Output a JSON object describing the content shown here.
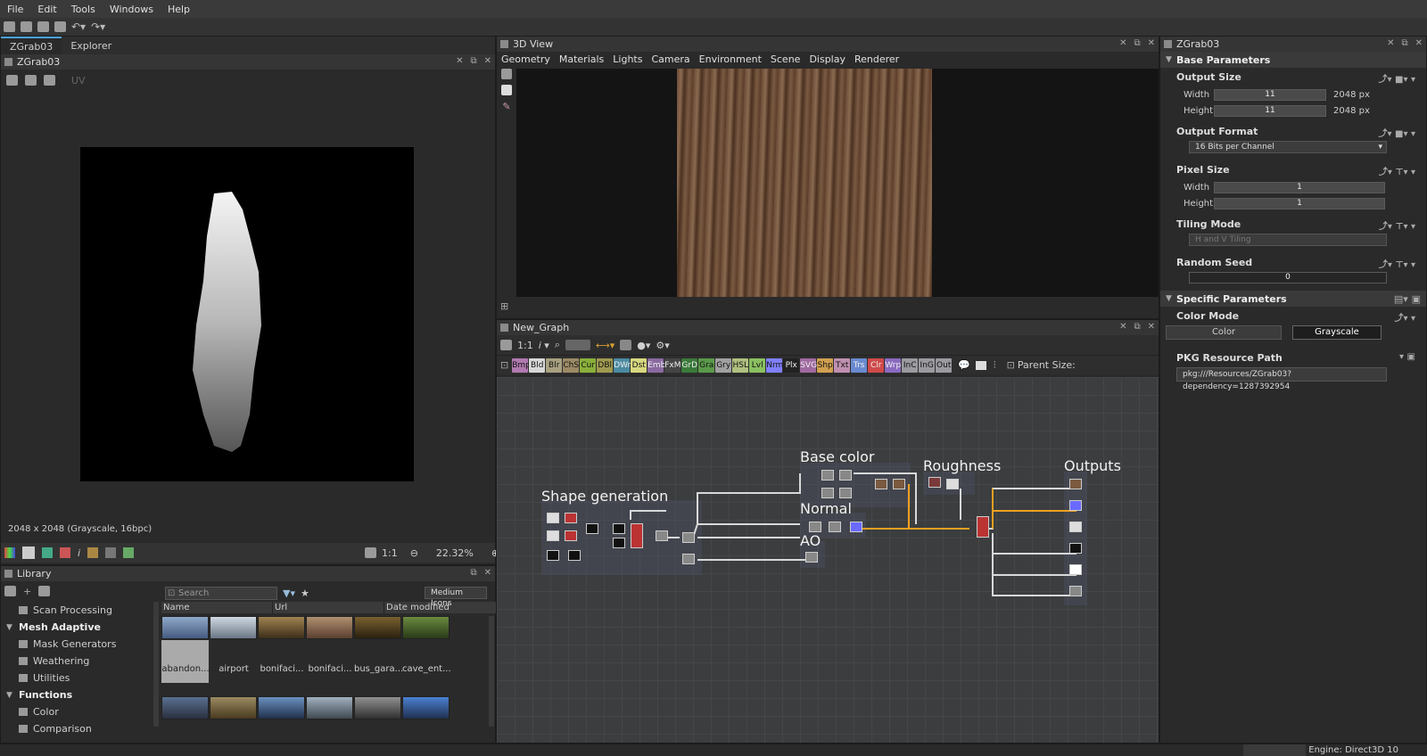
{
  "menu": [
    "File",
    "Edit",
    "Tools",
    "Windows",
    "Help"
  ],
  "left_panel": {
    "tabs": [
      "ZGrab03",
      "Explorer"
    ],
    "title": "ZGrab03",
    "uv_label": "UV",
    "image_info": "2048 x 2048 (Grayscale, 16bpc)",
    "zoom_ratio": "1:1",
    "zoom_percent": "22.32%"
  },
  "library": {
    "title": "Library",
    "search_placeholder": "Search",
    "view_mode": "Medium Icons",
    "columns": [
      "Name",
      "Url",
      "Date modified"
    ],
    "tree": [
      {
        "type": "item",
        "label": "Scan Processing"
      },
      {
        "type": "cat",
        "label": "Mesh Adaptive"
      },
      {
        "type": "item",
        "label": "Mask Generators"
      },
      {
        "type": "item",
        "label": "Weathering"
      },
      {
        "type": "item",
        "label": "Utilities"
      },
      {
        "type": "cat",
        "label": "Functions"
      },
      {
        "type": "item",
        "label": "Color"
      },
      {
        "type": "item",
        "label": "Comparison"
      }
    ],
    "thumbnails": [
      "abandon...",
      "airport",
      "bonifaci...",
      "bonifaci...",
      "bus_gara...",
      "cave_ent..."
    ]
  },
  "view3d": {
    "title": "3D View",
    "menu": [
      "Geometry",
      "Materials",
      "Lights",
      "Camera",
      "Environment",
      "Scene",
      "Display",
      "Renderer"
    ]
  },
  "graph": {
    "title": "New_Graph",
    "zoom_ratio": "1:1",
    "parent_size_label": "Parent Size:",
    "chips": [
      {
        "t": "Bmp",
        "c": "#b07ab0"
      },
      {
        "t": "Bld",
        "c": "#d8d8d8"
      },
      {
        "t": "Blr",
        "c": "#a8a080"
      },
      {
        "t": "ChS",
        "c": "#9c8a66"
      },
      {
        "t": "Cur",
        "c": "#8ab03a"
      },
      {
        "t": "DBl",
        "c": "#a09a50"
      },
      {
        "t": "DWr",
        "c": "#4a8aa0"
      },
      {
        "t": "Dst",
        "c": "#d8d880"
      },
      {
        "t": "Emb",
        "c": "#8a6aa0"
      },
      {
        "t": "FxM",
        "c": "#444"
      },
      {
        "t": "GrD",
        "c": "#3a7a3a"
      },
      {
        "t": "Gra",
        "c": "#5a9a4a"
      },
      {
        "t": "Gry",
        "c": "#a0a0a0"
      },
      {
        "t": "HSL",
        "c": "#b0c080"
      },
      {
        "t": "Lvl",
        "c": "#8ac060"
      },
      {
        "t": "Nrm",
        "c": "#8080ff"
      },
      {
        "t": "Plx",
        "c": "#222"
      },
      {
        "t": "SVG",
        "c": "#a06aa0"
      },
      {
        "t": "Shp",
        "c": "#d0a050"
      },
      {
        "t": "Txt",
        "c": "#c090b0"
      },
      {
        "t": "Trs",
        "c": "#6a8ad0"
      },
      {
        "t": "Clr",
        "c": "#d04a4a"
      },
      {
        "t": "Wrp",
        "c": "#8a6ac0"
      },
      {
        "t": "InC",
        "c": "#9a9aa0"
      },
      {
        "t": "InG",
        "c": "#9a9aa0"
      },
      {
        "t": "Out",
        "c": "#9a9aa0"
      }
    ],
    "frames": [
      "Shape generation",
      "Base color",
      "Normal",
      "AO",
      "Roughness",
      "Outputs"
    ]
  },
  "properties": {
    "title": "ZGrab03",
    "base_parameters": "Base Parameters",
    "output_size": {
      "label": "Output Size",
      "width_label": "Width",
      "height_label": "Height",
      "width": "11",
      "height": "11",
      "width_px": "2048 px",
      "height_px": "2048 px"
    },
    "output_format": {
      "label": "Output Format",
      "value": "16 Bits per Channel"
    },
    "pixel_size": {
      "label": "Pixel Size",
      "width_label": "Width",
      "height_label": "Height",
      "width": "1",
      "height": "1"
    },
    "tiling_mode": {
      "label": "Tiling Mode",
      "value": "H and V Tiling"
    },
    "random_seed": {
      "label": "Random Seed",
      "value": "0"
    },
    "specific_parameters": "Specific Parameters",
    "color_mode": {
      "label": "Color Mode",
      "options": [
        "Color",
        "Grayscale"
      ]
    },
    "pkg_resource": {
      "label": "PKG Resource Path",
      "value": "pkg:///Resources/ZGrab03?dependency=1287392954"
    }
  },
  "status": {
    "engine": "Engine: Direct3D 10"
  }
}
